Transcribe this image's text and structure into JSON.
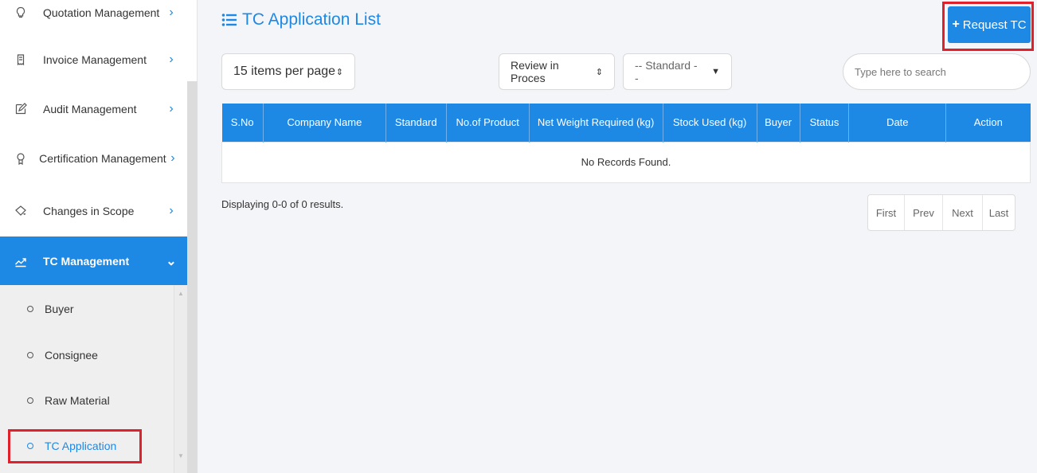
{
  "sidebar": {
    "items": [
      {
        "label": "Quotation Management",
        "icon": "bulb-icon"
      },
      {
        "label": "Invoice Management",
        "icon": "receipt-icon"
      },
      {
        "label": "Audit Management",
        "icon": "edit-icon"
      },
      {
        "label": "Certification Management",
        "icon": "award-icon"
      },
      {
        "label": "Changes in Scope",
        "icon": "bucket-icon"
      },
      {
        "label": "TC Management",
        "icon": "trend-icon",
        "active": true
      }
    ],
    "submenu": [
      {
        "label": "Buyer"
      },
      {
        "label": "Consignee"
      },
      {
        "label": "Raw Material"
      },
      {
        "label": "TC Application",
        "current": true
      }
    ]
  },
  "main": {
    "title": "TC Application List",
    "request_button": "Request TC",
    "per_page": "15 items per page",
    "status_filter": "Review in Proces",
    "standard_filter": "-- Standard --",
    "search_placeholder": "Type here to search",
    "table": {
      "columns": [
        "S.No",
        "Company Name",
        "Standard",
        "No.of Product",
        "Net Weight Required (kg)",
        "Stock Used (kg)",
        "Buyer",
        "Status",
        "Date",
        "Action"
      ],
      "empty_message": "No Records Found."
    },
    "display_info": "Displaying 0-0 of 0 results.",
    "pagination": [
      "First",
      "Prev",
      "Next",
      "Last"
    ]
  },
  "colors": {
    "accent": "#1e88e5",
    "highlight": "#e0202a"
  }
}
